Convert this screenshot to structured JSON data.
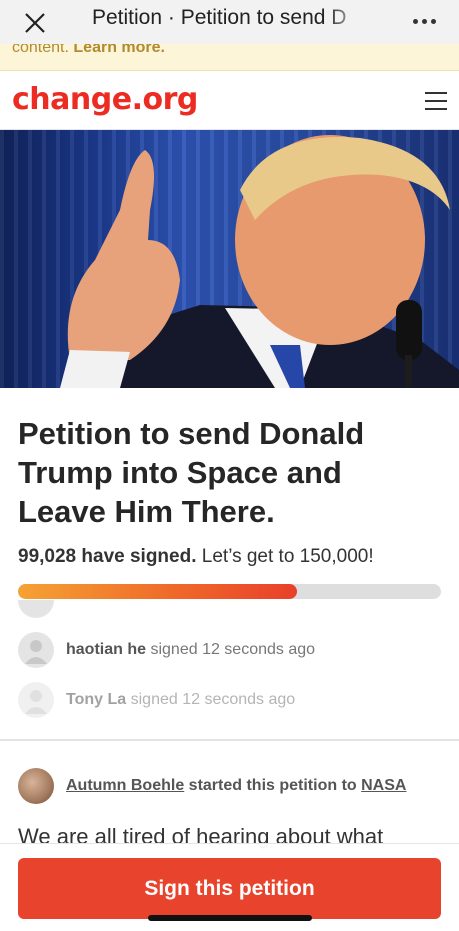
{
  "window": {
    "title": "Petition · Petition to send D"
  },
  "notice": {
    "text": "content.",
    "link": "Learn more."
  },
  "header": {
    "logo": "change.org"
  },
  "petition": {
    "title": "Petition to send Donald Trump into Space and Leave Him There.",
    "signed_count": "99,028 have signed.",
    "goal_text": "Let’s get to 150,000!",
    "progress_fraction": 0.66
  },
  "signers": [
    {
      "name": "haotian he",
      "action": "signed 12 seconds ago"
    },
    {
      "name": "Tony La",
      "action": "signed 12 seconds ago"
    }
  ],
  "starter": {
    "name": "Autumn Boehle",
    "middle": "started this petition to",
    "target": "NASA"
  },
  "body": {
    "first_line": "We are all tired of hearing about what"
  },
  "footer": {
    "sign_button": "Sign this petition"
  },
  "colors": {
    "brand": "#ec2c22",
    "button": "#e8442d"
  }
}
